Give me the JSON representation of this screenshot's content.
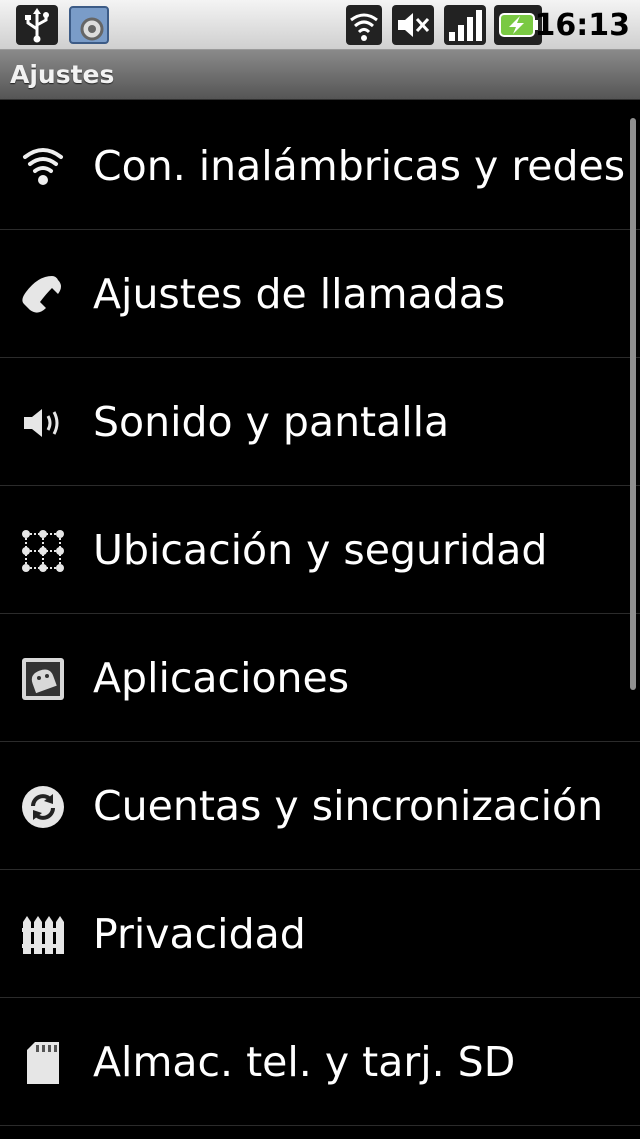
{
  "status_bar": {
    "time": "16:13",
    "icons": [
      "usb-icon",
      "settings-notification-icon",
      "wifi-icon",
      "mute-icon",
      "signal-icon",
      "battery-charging-icon"
    ]
  },
  "title_bar": {
    "title": "Ajustes"
  },
  "menu": {
    "items": [
      {
        "label": "Con. inalámbricas y redes",
        "icon": "wifi-icon"
      },
      {
        "label": "Ajustes de llamadas",
        "icon": "phone-icon"
      },
      {
        "label": "Sonido y pantalla",
        "icon": "speaker-icon"
      },
      {
        "label": "Ubicación y seguridad",
        "icon": "location-grid-icon"
      },
      {
        "label": "Aplicaciones",
        "icon": "android-app-icon"
      },
      {
        "label": "Cuentas y sincronización",
        "icon": "sync-icon"
      },
      {
        "label": "Privacidad",
        "icon": "fence-icon"
      },
      {
        "label": "Almac. tel. y tarj. SD",
        "icon": "sd-card-icon"
      }
    ]
  }
}
